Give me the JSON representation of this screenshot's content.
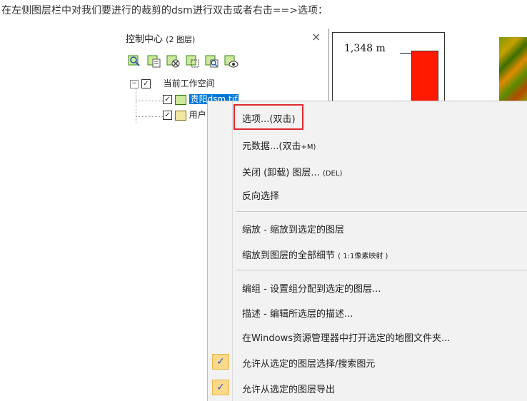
{
  "caption": "在左侧图层栏中对我们要进行的裁剪的dsm进行双击或者右击==>选项：",
  "panel": {
    "title": "控制中心",
    "layer_count": "(2 图层)",
    "close": "×",
    "toolbar_icons": [
      "add-layer-icon",
      "layer-list-icon",
      "remove-layer-icon",
      "layer-select-icon",
      "zoom-layer-icon",
      "view-layer-icon"
    ]
  },
  "tree": {
    "workspace": "当前工作空间",
    "layer1": "贵阳dsm.tif",
    "layer2": "用户"
  },
  "map": {
    "legend_label": "1,348 m",
    "colors": {
      "legend_bar": "#ff1a00"
    }
  },
  "menu": {
    "options": "选项...(双击)",
    "metadata": "元数据...(双击",
    "metadata_key": "+M)",
    "close_layer": "关闭 (卸载) 图层...",
    "close_key": "(DEL)",
    "invert": "反向选择",
    "zoom": "缩放 - 缩放到选定的图层",
    "zoom_full": "缩放到图层的全部细节",
    "zoom_full_key": "( 1:1像素映射 )",
    "group": "编组 - 设置组分配到选定的图层...",
    "describe": "描述 - 编辑所选层的描述...",
    "open_folder": "在Windows资源管理器中打开选定的地图文件夹...",
    "allow_select": "允许从选定的图层选择/搜索图元",
    "allow_export": "允许从选定的图层导出",
    "checkmark": "✓",
    "colors": {
      "highlight_border": "#e0282e",
      "check_bg": "#fbd88a"
    }
  }
}
